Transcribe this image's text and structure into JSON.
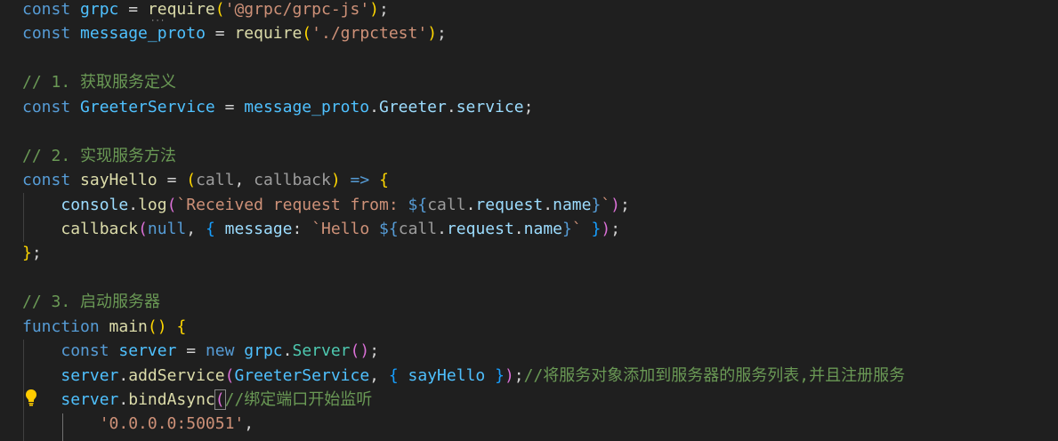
{
  "theme": {
    "background": "#1f1f1f",
    "keyword": "#569cd6",
    "variable": "#9cdcfe",
    "constant": "#4fc1ff",
    "function": "#dcdcaa",
    "string": "#ce9178",
    "comment": "#6a9955",
    "class": "#4ec9b0",
    "punctuation": "#d4d4d4",
    "bracket_gold": "#ffd700",
    "bracket_purple": "#da70d6",
    "bracket_blue": "#179fff",
    "unused_param": "#9d9d9d",
    "lightbulb": "#ffcc00"
  },
  "editor": {
    "lightbulb_icon": "lightbulb-icon",
    "lines": [
      [
        {
          "t": "const",
          "c": "keyword"
        },
        {
          "t": " ",
          "c": "punctuation"
        },
        {
          "t": "grpc",
          "c": "constant"
        },
        {
          "t": " = ",
          "c": "punctuation"
        },
        {
          "t": "require",
          "c": "function"
        },
        {
          "t": "(",
          "c": "bracket_gold"
        },
        {
          "t": "'@grpc/grpc-js'",
          "c": "string"
        },
        {
          "t": ")",
          "c": "bracket_gold"
        },
        {
          "t": ";",
          "c": "punctuation"
        }
      ],
      [
        {
          "t": "const",
          "c": "keyword"
        },
        {
          "t": " ",
          "c": "punctuation"
        },
        {
          "t": "message_proto",
          "c": "constant"
        },
        {
          "t": " = ",
          "c": "punctuation"
        },
        {
          "t": "require",
          "c": "function"
        },
        {
          "t": "(",
          "c": "bracket_gold"
        },
        {
          "t": "'./grpctest'",
          "c": "string"
        },
        {
          "t": ")",
          "c": "bracket_gold"
        },
        {
          "t": ";",
          "c": "punctuation"
        }
      ],
      [],
      [
        {
          "t": "// 1. 获取服务定义",
          "c": "comment"
        }
      ],
      [
        {
          "t": "const",
          "c": "keyword"
        },
        {
          "t": " ",
          "c": "punctuation"
        },
        {
          "t": "GreeterService",
          "c": "constant"
        },
        {
          "t": " = ",
          "c": "punctuation"
        },
        {
          "t": "message_proto",
          "c": "constant"
        },
        {
          "t": ".",
          "c": "punctuation"
        },
        {
          "t": "Greeter",
          "c": "variable"
        },
        {
          "t": ".",
          "c": "punctuation"
        },
        {
          "t": "service",
          "c": "variable"
        },
        {
          "t": ";",
          "c": "punctuation"
        }
      ],
      [],
      [
        {
          "t": "// 2. 实现服务方法",
          "c": "comment"
        }
      ],
      [
        {
          "t": "const",
          "c": "keyword"
        },
        {
          "t": " ",
          "c": "punctuation"
        },
        {
          "t": "sayHello",
          "c": "function"
        },
        {
          "t": " = ",
          "c": "punctuation"
        },
        {
          "t": "(",
          "c": "bracket_gold"
        },
        {
          "t": "call",
          "c": "unused_param"
        },
        {
          "t": ", ",
          "c": "punctuation"
        },
        {
          "t": "callback",
          "c": "unused_param"
        },
        {
          "t": ")",
          "c": "bracket_gold"
        },
        {
          "t": " ",
          "c": "punctuation"
        },
        {
          "t": "=>",
          "c": "keyword"
        },
        {
          "t": " ",
          "c": "punctuation"
        },
        {
          "t": "{",
          "c": "bracket_gold"
        }
      ],
      [
        {
          "t": "    ",
          "c": "punctuation"
        },
        {
          "t": "console",
          "c": "variable"
        },
        {
          "t": ".",
          "c": "punctuation"
        },
        {
          "t": "log",
          "c": "function"
        },
        {
          "t": "(",
          "c": "bracket_purple"
        },
        {
          "t": "`Received request from: ",
          "c": "string"
        },
        {
          "t": "${",
          "c": "keyword"
        },
        {
          "t": "call",
          "c": "unused_param"
        },
        {
          "t": ".",
          "c": "punctuation"
        },
        {
          "t": "request",
          "c": "variable"
        },
        {
          "t": ".",
          "c": "punctuation"
        },
        {
          "t": "name",
          "c": "variable"
        },
        {
          "t": "}",
          "c": "keyword"
        },
        {
          "t": "`",
          "c": "string"
        },
        {
          "t": ")",
          "c": "bracket_purple"
        },
        {
          "t": ";",
          "c": "punctuation"
        }
      ],
      [
        {
          "t": "    ",
          "c": "punctuation"
        },
        {
          "t": "callback",
          "c": "function"
        },
        {
          "t": "(",
          "c": "bracket_purple"
        },
        {
          "t": "null",
          "c": "keyword"
        },
        {
          "t": ", ",
          "c": "punctuation"
        },
        {
          "t": "{",
          "c": "bracket_blue"
        },
        {
          "t": " ",
          "c": "punctuation"
        },
        {
          "t": "message",
          "c": "variable"
        },
        {
          "t": ": ",
          "c": "punctuation"
        },
        {
          "t": "`Hello ",
          "c": "string"
        },
        {
          "t": "${",
          "c": "keyword"
        },
        {
          "t": "call",
          "c": "unused_param"
        },
        {
          "t": ".",
          "c": "punctuation"
        },
        {
          "t": "request",
          "c": "variable"
        },
        {
          "t": ".",
          "c": "punctuation"
        },
        {
          "t": "name",
          "c": "variable"
        },
        {
          "t": "}",
          "c": "keyword"
        },
        {
          "t": "`",
          "c": "string"
        },
        {
          "t": " ",
          "c": "punctuation"
        },
        {
          "t": "}",
          "c": "bracket_blue"
        },
        {
          "t": ")",
          "c": "bracket_purple"
        },
        {
          "t": ";",
          "c": "punctuation"
        }
      ],
      [
        {
          "t": "}",
          "c": "bracket_gold"
        },
        {
          "t": ";",
          "c": "punctuation"
        }
      ],
      [],
      [
        {
          "t": "// 3. 启动服务器",
          "c": "comment"
        }
      ],
      [
        {
          "t": "function",
          "c": "keyword"
        },
        {
          "t": " ",
          "c": "punctuation"
        },
        {
          "t": "main",
          "c": "function"
        },
        {
          "t": "(",
          "c": "bracket_gold"
        },
        {
          "t": ")",
          "c": "bracket_gold"
        },
        {
          "t": " ",
          "c": "punctuation"
        },
        {
          "t": "{",
          "c": "bracket_gold"
        }
      ],
      [
        {
          "t": "    ",
          "c": "punctuation"
        },
        {
          "t": "const",
          "c": "keyword"
        },
        {
          "t": " ",
          "c": "punctuation"
        },
        {
          "t": "server",
          "c": "constant"
        },
        {
          "t": " = ",
          "c": "punctuation"
        },
        {
          "t": "new",
          "c": "keyword"
        },
        {
          "t": " ",
          "c": "punctuation"
        },
        {
          "t": "grpc",
          "c": "constant"
        },
        {
          "t": ".",
          "c": "punctuation"
        },
        {
          "t": "Server",
          "c": "class"
        },
        {
          "t": "(",
          "c": "bracket_purple"
        },
        {
          "t": ")",
          "c": "bracket_purple"
        },
        {
          "t": ";",
          "c": "punctuation"
        }
      ],
      [
        {
          "t": "    ",
          "c": "punctuation"
        },
        {
          "t": "server",
          "c": "constant"
        },
        {
          "t": ".",
          "c": "punctuation"
        },
        {
          "t": "addService",
          "c": "function"
        },
        {
          "t": "(",
          "c": "bracket_purple"
        },
        {
          "t": "GreeterService",
          "c": "constant"
        },
        {
          "t": ", ",
          "c": "punctuation"
        },
        {
          "t": "{",
          "c": "bracket_blue"
        },
        {
          "t": " ",
          "c": "punctuation"
        },
        {
          "t": "sayHello",
          "c": "constant"
        },
        {
          "t": " ",
          "c": "punctuation"
        },
        {
          "t": "}",
          "c": "bracket_blue"
        },
        {
          "t": ")",
          "c": "bracket_purple"
        },
        {
          "t": ";",
          "c": "punctuation"
        },
        {
          "t": "//将服务对象添加到服务器的服务列表,并且注册服务",
          "c": "comment"
        }
      ],
      [
        {
          "t": "    ",
          "c": "punctuation"
        },
        {
          "t": "server",
          "c": "constant"
        },
        {
          "t": ".",
          "c": "punctuation"
        },
        {
          "t": "bindAsync",
          "c": "function"
        },
        {
          "t": "(",
          "c": "bracket_purple",
          "cursor": true
        },
        {
          "t": "//绑定端口开始监听",
          "c": "comment"
        }
      ],
      [
        {
          "t": "        ",
          "c": "punctuation"
        },
        {
          "t": "'0.0.0.0:50051'",
          "c": "string"
        },
        {
          "t": ",",
          "c": "punctuation"
        }
      ]
    ]
  }
}
